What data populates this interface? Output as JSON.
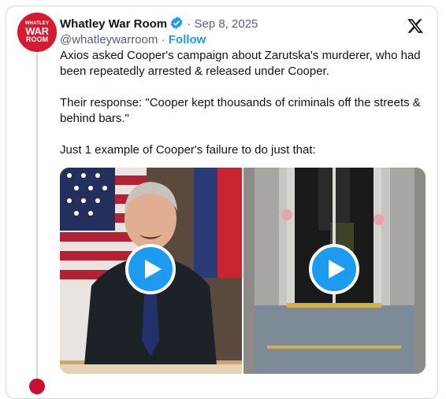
{
  "tweet": {
    "author_name": "Whatley War Room",
    "separator": "·",
    "date": "Sep 8, 2025",
    "handle": "@whatleywarroom",
    "follow_label": "Follow",
    "paragraphs": [
      "Axios asked Cooper's campaign about Zarutska's murderer, who had been repeatedly arrested & released under Cooper.",
      "Their response: \"Cooper kept thousands of criminals off the streets & behind bars.\"",
      "Just 1 example of Cooper's failure to do just that:"
    ]
  },
  "avatar": {
    "line1": "WHATLEY",
    "line2": "WAR",
    "line3": "ROOM"
  },
  "icons": {
    "verified": "verified-badge-icon",
    "platform": "x-logo-icon",
    "play": "play-icon"
  },
  "colors": {
    "accent": "#1d9bf0",
    "brand_red": "#d71a30"
  }
}
